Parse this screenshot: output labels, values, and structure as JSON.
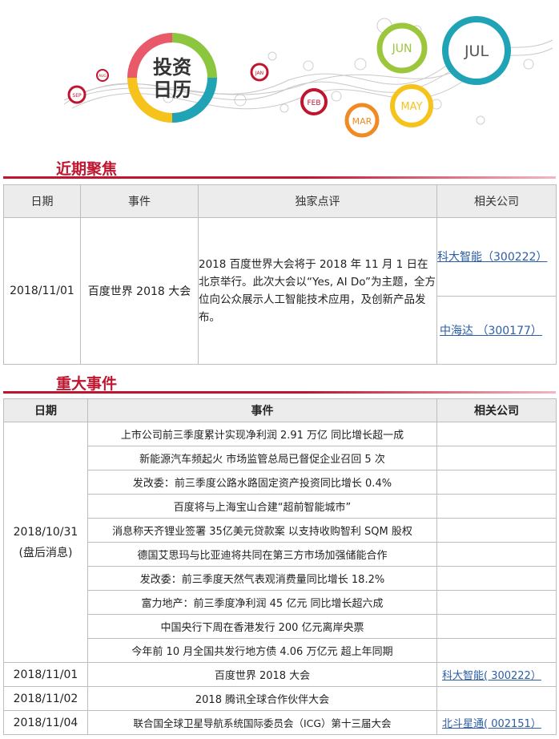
{
  "banner": {
    "logo_line1": "投资",
    "logo_line2": "日历",
    "months": [
      "SEP",
      "AUG",
      "JAN",
      "FEB",
      "MAR",
      "MAY",
      "JUN",
      "JUL"
    ],
    "colors": {
      "jun": "#9cc63b",
      "jul": "#1fa3b5",
      "may": "#f5c31c",
      "mar": "#f08a24",
      "feb": "#c0152f"
    }
  },
  "focus": {
    "title": "近期聚焦",
    "headers": [
      "日期",
      "事件",
      "独家点评",
      "相关公司"
    ],
    "row": {
      "date": "2018/11/01",
      "event": "百度世界 2018 大会",
      "comment": "2018 百度世界大会将于 2018 年 11 月 1 日在北京举行。此次大会以“Yes, AI Do”为主题，全方位向公众展示人工智能技术应用，及创新产品发布。",
      "companies": [
        "科大智能（300222）",
        "中海达 （300177）"
      ]
    }
  },
  "major": {
    "title": "重大事件",
    "headers": [
      "日期",
      "事件",
      "相关公司"
    ],
    "group_date": "2018/10/31",
    "group_note": "(盘后消息)",
    "group_events": [
      "上市公司前三季度累计实现净利润 2.91 万亿 同比增长超一成",
      "新能源汽车频起火 市场监管总局已督促企业召回 5 次",
      "发改委：前三季度公路水路固定资产投资同比增长 0.4%",
      "百度将与上海宝山合建“超前智能城市”",
      "消息称天齐锂业签署 35亿美元贷款案 以支持收购智利 SQM 股权",
      "德国艾思玛与比亚迪将共同在第三方市场加强储能合作",
      "发改委：前三季度天然气表观消费量同比增长 18.2%",
      "富力地产：前三季度净利润 45 亿元 同比增长超六成",
      "中国央行下周在香港发行 200 亿元离岸央票",
      "今年前 10 月全国共发行地方债 4.06 万亿元 超上年同期"
    ],
    "rows": [
      {
        "date": "2018/11/01",
        "event": "百度世界 2018 大会",
        "company": "科大智能( 300222）"
      },
      {
        "date": "2018/11/02",
        "event": "2018 腾讯全球合作伙伴大会",
        "company": ""
      },
      {
        "date": "2018/11/04",
        "event": "联合国全球卫星导航系统国际委员会（ICG）第十三届大会",
        "company": "北斗星通( 002151）"
      }
    ]
  }
}
